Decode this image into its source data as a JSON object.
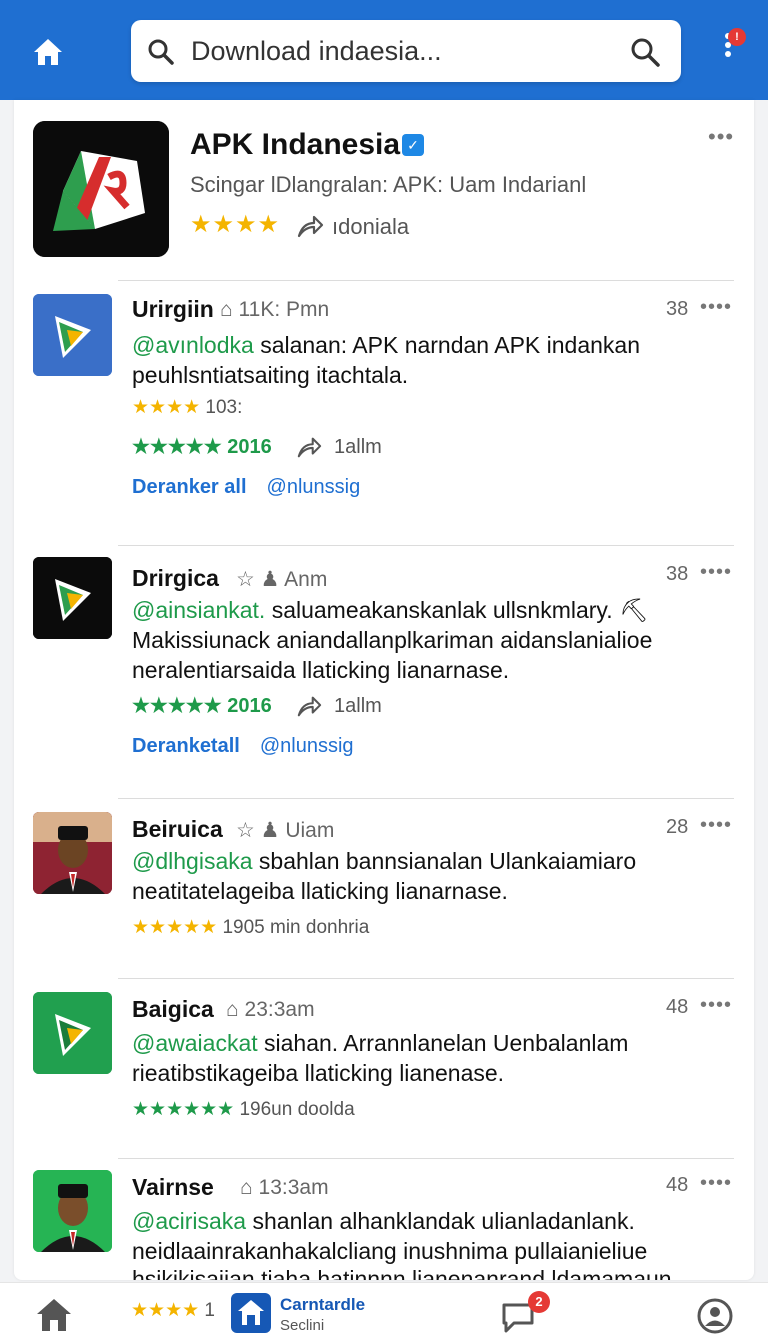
{
  "search": {
    "query": "Download indaesia..."
  },
  "notifications": {
    "badge": "!"
  },
  "app": {
    "title": "APK Indanesia",
    "subtitle": "Scingar lDlangralan: APK: Uam Indarianl",
    "rating_stars": "★★★★",
    "rating_value": 3.5,
    "shares": "ıdoniala",
    "more": "•••"
  },
  "posts": [
    {
      "name": "Urirgiin",
      "meta": "11K: Pmn",
      "count": "38",
      "more": "••••",
      "handle": "@avınlodka",
      "text1": " salanan: APK narndan APK indankan",
      "text2": "peuhlsntiatsaiting itachtala.",
      "rating_stars": "★★★★",
      "rating_count": "103:",
      "green_stars": "★★★★★",
      "green_year": "2016",
      "shares": "1allm",
      "link1": "Deranker all",
      "link2": "@nlunssig"
    },
    {
      "name": "Drirgica",
      "meta": "Anm",
      "count": "38",
      "more": "••••",
      "handle": "@ainsiankat.",
      "text1": " saluameakanskanlak ullsnkmlary. ⛏",
      "text2": "Makissiunack aniandallanplkariman aidanslanialioe",
      "text3": "neralentiarsaida llaticking lianarnase.",
      "green_stars": "★★★★★",
      "green_year": "2016",
      "shares": "1allm",
      "link1": "Deranketall",
      "link2": "@nlunssig"
    },
    {
      "name": "Beiruica",
      "meta": "Uiam",
      "count": "28",
      "more": "••••",
      "handle": "@dlhgisaka",
      "text1": " sbahlan bannsianalan Ulankaiamiaro",
      "text2": "neatitatelageiba llaticking lianarnase.",
      "rating_stars": "★★★★★",
      "rating_count": "1905 min donhria"
    },
    {
      "name": "Baigica",
      "meta": "23:3am",
      "count": "48",
      "more": "••••",
      "handle": "@awaiackat",
      "text1": " siahan. Arrannlanelan Uenbalanlam",
      "text2": "rieatibstikageiba llaticking lianenase.",
      "green_stars": "★★★★★★",
      "rating_count": "196un doolda"
    },
    {
      "name": "Vairnse",
      "meta": "13:3am",
      "count": "48",
      "more": "••••",
      "handle": "@acirisaka",
      "text1": " shanlan alhanklandak ulianladanlank.",
      "text2": "neidlaainrakanhakalcliang inushnima pullaianieliue",
      "text3": "hsikikisaiian tiaha hatinnnn lianenanrand ldamamaun"
    }
  ],
  "bottom_nav": {
    "rating_stars": "★★★★",
    "rating_num": "1",
    "app_title": "Carntardle",
    "app_sub": "Seclini",
    "chat_badge": "2"
  },
  "colors": {
    "primary": "#1f6fd1",
    "green": "#1e9a4a",
    "star": "#f4b400",
    "badge": "#e53935"
  }
}
